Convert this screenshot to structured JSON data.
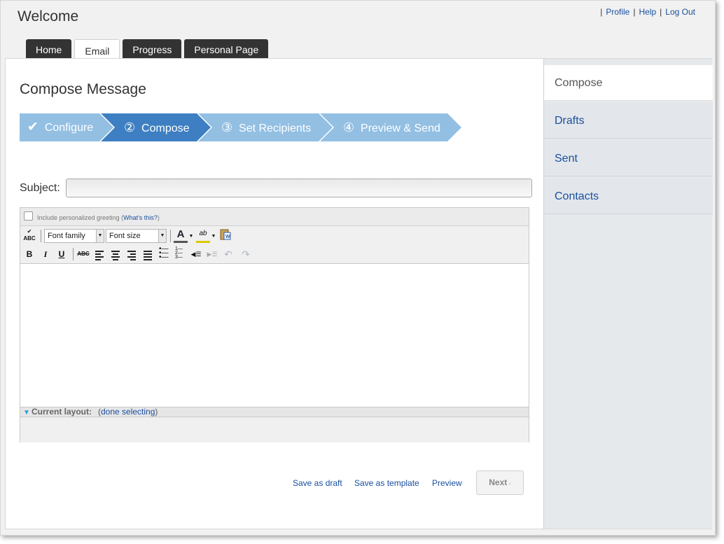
{
  "header": {
    "title": "Welcome",
    "links": [
      {
        "label": "Profile"
      },
      {
        "label": "Help"
      },
      {
        "label": "Log Out"
      }
    ]
  },
  "tabs": [
    {
      "label": "Home",
      "active": false
    },
    {
      "label": "Email",
      "active": true
    },
    {
      "label": "Progress",
      "active": false
    },
    {
      "label": "Personal Page",
      "active": false
    }
  ],
  "page": {
    "title": "Compose Message"
  },
  "wizard": {
    "steps": [
      {
        "icon": "✔",
        "label": "Configure",
        "state": "done"
      },
      {
        "icon": "②",
        "label": "Compose",
        "state": "current"
      },
      {
        "icon": "③",
        "label": "Set Recipients",
        "state": "pending"
      },
      {
        "icon": "④",
        "label": "Preview & Send",
        "state": "pending"
      }
    ]
  },
  "form": {
    "subject_label": "Subject:",
    "subject_value": ""
  },
  "editor": {
    "greeting_label": "Include personalized greeting (",
    "greeting_link": "What's this?",
    "greeting_close": ")",
    "font_family": "Font family",
    "font_size": "Font size",
    "status_label": "Current layout:",
    "status_open": "(",
    "status_link": "done selecting",
    "status_close": ")"
  },
  "actions": {
    "save_draft": "Save as draft",
    "save_template": "Save as template",
    "preview": "Preview",
    "next": "Next"
  },
  "sidebar": {
    "items": [
      {
        "label": "Compose",
        "active": true
      },
      {
        "label": "Drafts",
        "active": false
      },
      {
        "label": "Sent",
        "active": false
      },
      {
        "label": "Contacts",
        "active": false
      }
    ]
  },
  "colors": {
    "accent": "#3d7fc2",
    "step_pending": "#93bfe3",
    "link": "#1a4fa0",
    "tab_dark": "#333333"
  }
}
